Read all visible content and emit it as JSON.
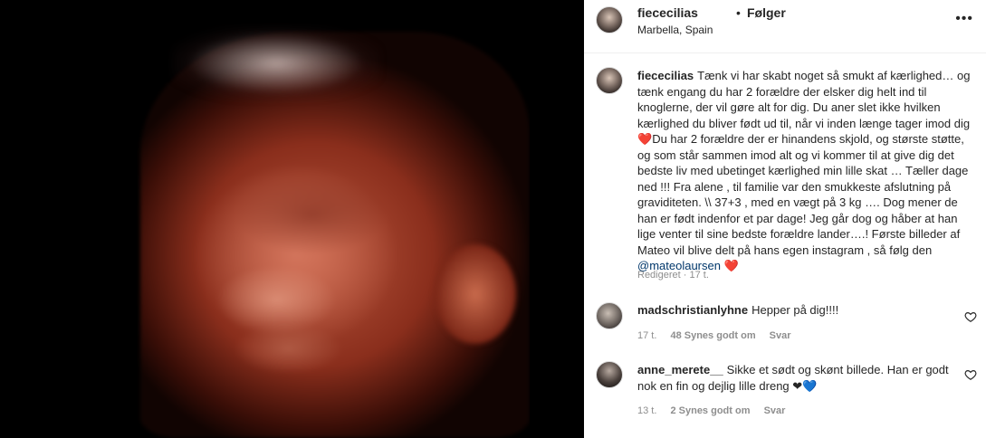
{
  "media": {
    "description_icon": "ultrasound-photo"
  },
  "header": {
    "username": "fiececilias",
    "separator": "•",
    "follow_label": "Følger",
    "location": "Marbella, Spain"
  },
  "caption": {
    "username": "fiececilias",
    "text_part1": "Tænk vi har skabt noget så smukt af kærlighed… og tænk engang du har 2 forældre der elsker dig helt ind til knoglerne, der vil gøre alt for dig. Du aner slet ikke hvilken kærlighed du bliver født ud til, når vi inden længe tager imod dig ",
    "heart1": "❤️",
    "text_part2": "Du har 2 forældre der er hinandens skjold, og største støtte, og som står sammen imod alt og vi kommer til at give dig det bedste liv med ubetinget kærlighed min lille skat … Tæller dage ned !!! Fra alene , til familie var den smukkeste afslutning på graviditeten. \\\\ 37+3 , med en vægt på 3 kg …. Dog mener de han er født indenfor et par dage! Jeg går dog og håber at han lige venter til sine bedste forældre lander….! Første billeder af Mateo vil blive delt på hans egen instagram , så følg den ",
    "mention": "@mateolaursen",
    "heart2": "❤️",
    "meta": "Redigeret · 17 t."
  },
  "comments": [
    {
      "username": "madschristianlyhne",
      "text": "Hepper på dig!!!!",
      "time": "17 t.",
      "likes": "48 Synes godt om",
      "reply": "Svar"
    },
    {
      "username": "anne_merete__",
      "text": "Sikke et sødt og skønt billede. Han er godt nok en fin og dejlig lille dreng ❤💙",
      "time": "13 t.",
      "likes": "2 Synes godt om",
      "reply": "Svar"
    }
  ],
  "colors": {
    "text": "#262626",
    "muted": "#8e8e8e",
    "link": "#00376b",
    "heart": "#ed1c24"
  }
}
